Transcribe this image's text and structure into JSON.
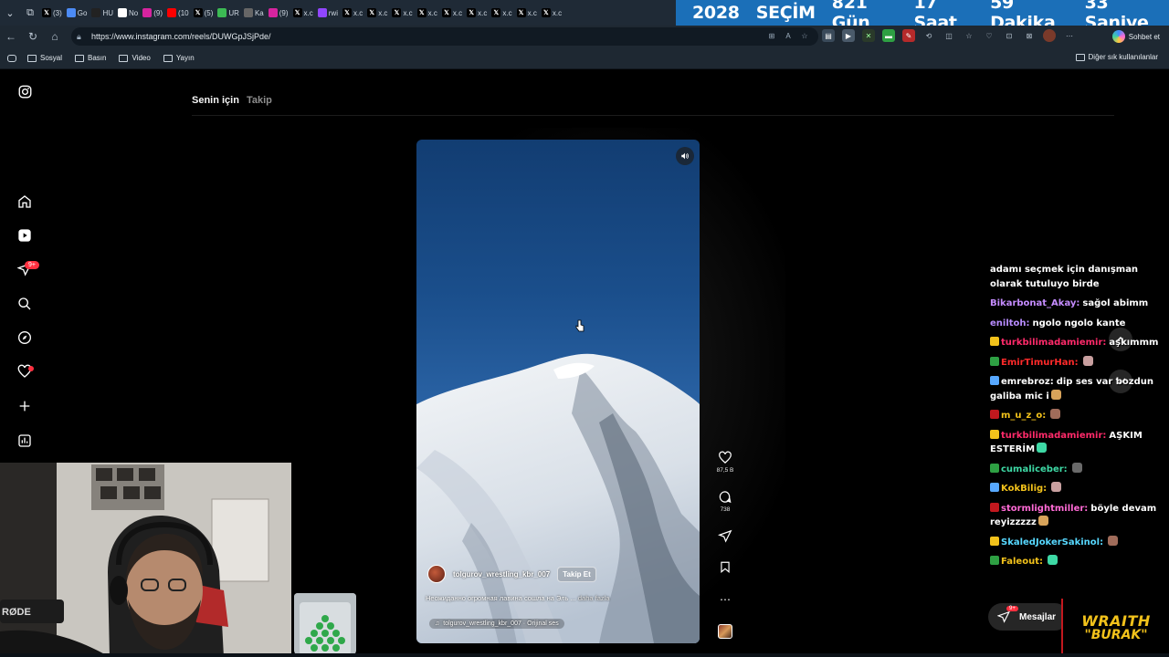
{
  "browser": {
    "tabs": [
      {
        "label": "(3)",
        "icon": "x-icon",
        "color": "#000000"
      },
      {
        "label": "Go",
        "icon": "gemini-icon",
        "color": "#4c8bf5"
      },
      {
        "label": "HU",
        "icon": "news-icon",
        "color": "#222222"
      },
      {
        "label": "No",
        "icon": "notion-icon",
        "color": "#ffffff"
      },
      {
        "label": "(9)",
        "icon": "instagram-icon",
        "color": "#d6249f"
      },
      {
        "label": "(10",
        "icon": "youtube-icon",
        "color": "#ff0000"
      },
      {
        "label": "(5)",
        "icon": "x-icon",
        "color": "#000000"
      },
      {
        "label": "UR",
        "icon": "shop-icon",
        "color": "#3cba54"
      },
      {
        "label": "Ka",
        "icon": "doc-icon",
        "color": "#666666"
      },
      {
        "label": "(9)",
        "icon": "instagram-icon",
        "color": "#d6249f"
      },
      {
        "label": "x.c",
        "icon": "x-icon",
        "color": "#000000"
      },
      {
        "label": "rwi",
        "icon": "twitch-icon",
        "color": "#9146ff"
      },
      {
        "label": "x.c",
        "icon": "x-icon",
        "color": "#000000"
      },
      {
        "label": "x.c",
        "icon": "x-icon",
        "color": "#000000"
      },
      {
        "label": "x.c",
        "icon": "x-icon",
        "color": "#000000"
      },
      {
        "label": "x.c",
        "icon": "x-icon",
        "color": "#000000"
      },
      {
        "label": "x.c",
        "icon": "x-icon",
        "color": "#000000"
      },
      {
        "label": "x.c",
        "icon": "x-icon",
        "color": "#000000"
      },
      {
        "label": "x.c",
        "icon": "x-icon",
        "color": "#000000"
      },
      {
        "label": "x.c",
        "icon": "x-icon",
        "color": "#000000"
      },
      {
        "label": "x.c",
        "icon": "x-icon",
        "color": "#000000"
      }
    ],
    "countdown": {
      "year": "2028",
      "election": "SEÇİM",
      "days": "821 Gün",
      "hours": "17 Saat",
      "minutes": "59 Dakika",
      "seconds": "33 Saniye"
    },
    "url": "https://www.instagram.com/reels/DUWGpJSjPde/",
    "copilot_label": "Sohbet et",
    "bookmarks": [
      "Sosyal",
      "Basın",
      "Video",
      "Yayın"
    ],
    "other_bookmarks": "Diğer sık kullanılanlar"
  },
  "instagram": {
    "feed_tabs": {
      "for_you": "Senin için",
      "following": "Takip"
    },
    "notification_badge": "9+",
    "reel": {
      "author": "tolgurov_wrestling_kbr_007",
      "follow_label": "Takip Et",
      "caption": "Неожиданно огромная лавина сошла на Эль ...",
      "caption_more": "daha fazla",
      "audio": "tolgurov_wrestling_kbr_007 · Orijinal ses",
      "likes": "87,5 B",
      "comments": "738"
    },
    "messages": {
      "label": "Mesajlar",
      "badge": "9+"
    }
  },
  "chat": [
    {
      "user": "",
      "text": "adamı seçmek için danışman olarak tutuluyo birde",
      "color": "#ffffff"
    },
    {
      "user": "Bikarbonat_Akay:",
      "text": "sağol abimm",
      "color": "#c58cff"
    },
    {
      "user": "eniltoh:",
      "text": "ngolo ngolo kante",
      "color": "#b88cff"
    },
    {
      "user": "turkbilimadamiemir:",
      "text": "aşkımmm",
      "color": "#ff2a6a"
    },
    {
      "user": "EmirTimurHan:",
      "text": "",
      "color": "#ff2a2a"
    },
    {
      "user": "emrebroz:",
      "text": "dip ses var bozdun galiba mic i",
      "color": "#ffffff"
    },
    {
      "user": "m_u_z_o:",
      "text": "",
      "color": "#f2c21b"
    },
    {
      "user": "turkbilimadamiemir:",
      "text": "AŞKIM ESTERİM",
      "color": "#ff2a6a"
    },
    {
      "user": "cumaliceber:",
      "text": "",
      "color": "#3ed9a5"
    },
    {
      "user": "KokBilig:",
      "text": "",
      "color": "#f2c21b"
    },
    {
      "user": "stormlightmiller:",
      "text": "böyle devam reyizzzzz",
      "color": "#ff6ad5"
    },
    {
      "user": "SkaledJokerSakinol:",
      "text": "",
      "color": "#57d8ff"
    },
    {
      "user": "Faleout:",
      "text": "",
      "color": "#f2c21b"
    }
  ],
  "overlay": {
    "logo_line1": "WRAITH",
    "logo_line2": "\"BURAK\""
  }
}
